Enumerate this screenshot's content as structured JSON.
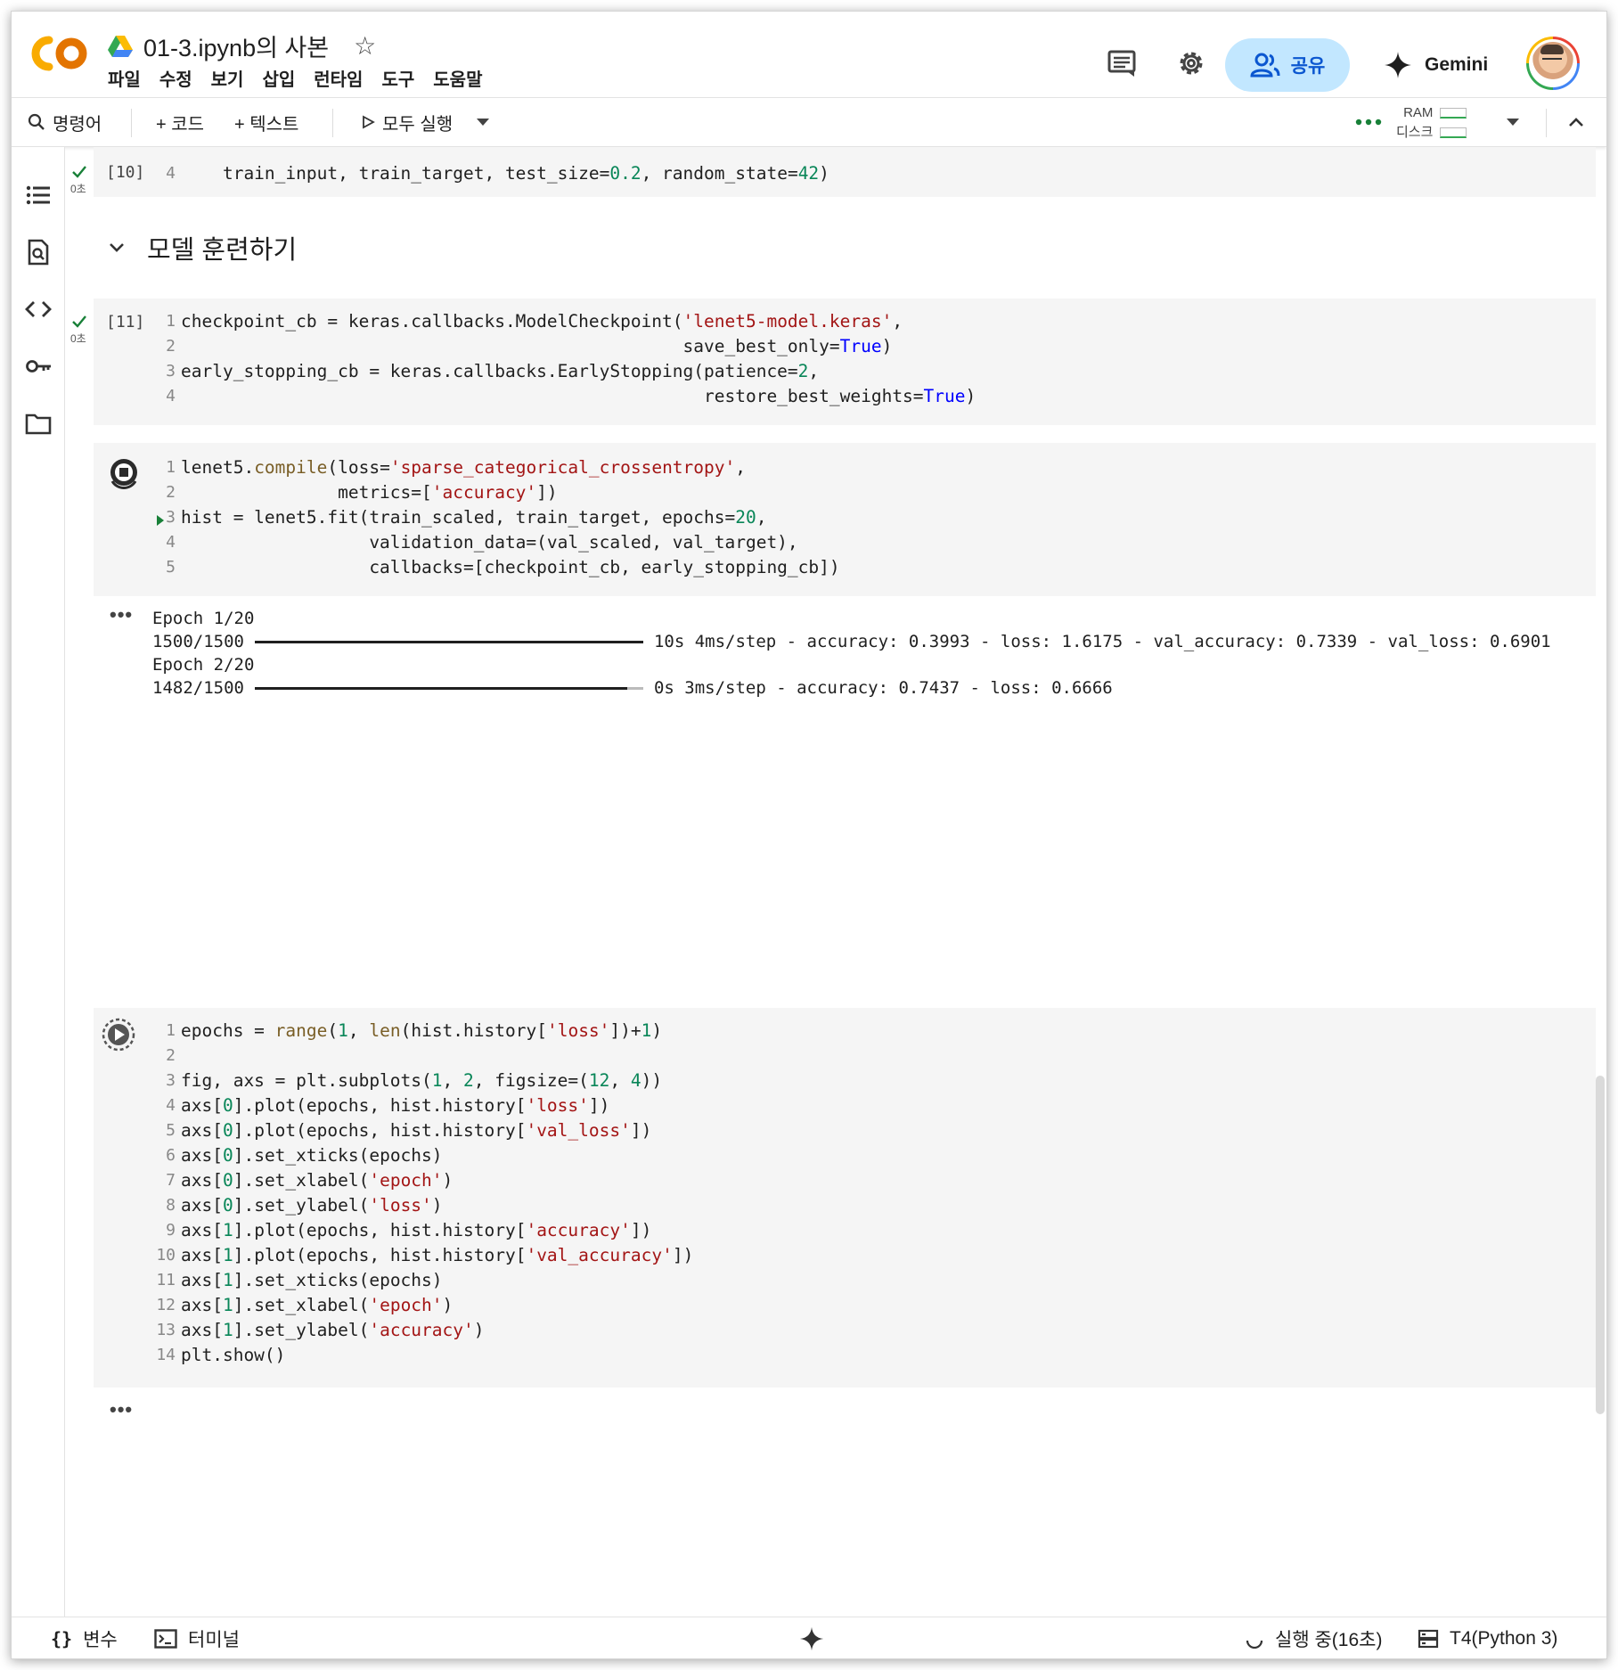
{
  "header": {
    "logo_text": "CO",
    "title": "01-3.ipynb의 사본",
    "menu": [
      "파일",
      "수정",
      "보기",
      "삽입",
      "런타임",
      "도구",
      "도움말"
    ],
    "share_label": "공유",
    "gemini_label": "Gemini"
  },
  "toolbar": {
    "commands_label": "명령어",
    "add_code_label": "+ 코드",
    "add_text_label": "+ 텍스트",
    "run_all_label": "모두 실행",
    "ram_label": "RAM",
    "disk_label": "디스크"
  },
  "cells": {
    "c10": {
      "exec_count": "[10]",
      "time": "0초",
      "lines": [
        {
          "n": "4",
          "segs": [
            [
              "",
              "    train_input, train_target, test_size="
            ],
            [
              "num",
              "0.2"
            ],
            [
              "",
              ", random_state="
            ],
            [
              "num",
              "42"
            ],
            [
              "",
              ")"
            ]
          ]
        }
      ]
    },
    "section": {
      "title": "모델 훈련하기"
    },
    "c11": {
      "exec_count": "[11]",
      "time": "0초",
      "lines": [
        {
          "n": "1",
          "segs": [
            [
              "",
              "checkpoint_cb = keras.callbacks.ModelCheckpoint("
            ],
            [
              "str",
              "'lenet5-model.keras'"
            ],
            [
              "",
              ","
            ]
          ]
        },
        {
          "n": "2",
          "segs": [
            [
              "",
              "                                                save_best_only="
            ],
            [
              "kw",
              "True"
            ],
            [
              "",
              ")"
            ]
          ]
        },
        {
          "n": "3",
          "segs": [
            [
              "",
              "early_stopping_cb = keras.callbacks.EarlyStopping(patience="
            ],
            [
              "num",
              "2"
            ],
            [
              "",
              ","
            ]
          ]
        },
        {
          "n": "4",
          "segs": [
            [
              "",
              "                                                  restore_best_weights="
            ],
            [
              "kw",
              "True"
            ],
            [
              "",
              ")"
            ]
          ]
        }
      ]
    },
    "c12": {
      "lines": [
        {
          "n": "1",
          "segs": [
            [
              "",
              "lenet5."
            ],
            [
              "fn",
              "compile"
            ],
            [
              "",
              "(loss="
            ],
            [
              "str",
              "'sparse_categorical_crossentropy'"
            ],
            [
              "",
              ","
            ]
          ]
        },
        {
          "n": "2",
          "segs": [
            [
              "",
              "               metrics=["
            ],
            [
              "str",
              "'accuracy'"
            ],
            [
              "",
              "])"
            ]
          ]
        },
        {
          "n": "3",
          "segs": [
            [
              "",
              "hist = lenet5.fit(train_scaled, train_target, epochs="
            ],
            [
              "num",
              "20"
            ],
            [
              "",
              ","
            ]
          ]
        },
        {
          "n": "4",
          "segs": [
            [
              "",
              "                  validation_data=(val_scaled, val_target),"
            ]
          ]
        },
        {
          "n": "5",
          "segs": [
            [
              "",
              "                  callbacks=[checkpoint_cb, early_stopping_cb])"
            ]
          ]
        }
      ],
      "output": {
        "epoch1": "Epoch 1/20",
        "step1": "1500/1500",
        "stats1": "10s 4ms/step - accuracy: 0.3993 - loss: 1.6175 - val_accuracy: 0.7339 - val_loss: 0.6901",
        "epoch2": "Epoch 2/20",
        "step2": "1482/1500",
        "stats2": "0s 3ms/step - accuracy: 0.7437 - loss: 0.6666"
      }
    },
    "c13": {
      "lines": [
        {
          "n": "1",
          "segs": [
            [
              "",
              "epochs = "
            ],
            [
              "fn",
              "range"
            ],
            [
              "",
              "("
            ],
            [
              "num",
              "1"
            ],
            [
              "",
              ", "
            ],
            [
              "fn",
              "len"
            ],
            [
              "",
              "(hist.history["
            ],
            [
              "str",
              "'loss'"
            ],
            [
              "",
              "])+"
            ],
            [
              "num",
              "1"
            ],
            [
              "",
              ")"
            ]
          ]
        },
        {
          "n": "2",
          "segs": [
            [
              "",
              ""
            ]
          ]
        },
        {
          "n": "3",
          "segs": [
            [
              "",
              "fig, axs = plt.subplots("
            ],
            [
              "num",
              "1"
            ],
            [
              "",
              ", "
            ],
            [
              "num",
              "2"
            ],
            [
              "",
              ", figsize=("
            ],
            [
              "num",
              "12"
            ],
            [
              "",
              ", "
            ],
            [
              "num",
              "4"
            ],
            [
              "",
              "))"
            ]
          ]
        },
        {
          "n": "4",
          "segs": [
            [
              "",
              "axs["
            ],
            [
              "num",
              "0"
            ],
            [
              "",
              "].plot(epochs, hist.history["
            ],
            [
              "str",
              "'loss'"
            ],
            [
              "",
              "])"
            ]
          ]
        },
        {
          "n": "5",
          "segs": [
            [
              "",
              "axs["
            ],
            [
              "num",
              "0"
            ],
            [
              "",
              "].plot(epochs, hist.history["
            ],
            [
              "str",
              "'val_loss'"
            ],
            [
              "",
              "])"
            ]
          ]
        },
        {
          "n": "6",
          "segs": [
            [
              "",
              "axs["
            ],
            [
              "num",
              "0"
            ],
            [
              "",
              "].set_xticks(epochs)"
            ]
          ]
        },
        {
          "n": "7",
          "segs": [
            [
              "",
              "axs["
            ],
            [
              "num",
              "0"
            ],
            [
              "",
              "].set_xlabel("
            ],
            [
              "str",
              "'epoch'"
            ],
            [
              "",
              ")"
            ]
          ]
        },
        {
          "n": "8",
          "segs": [
            [
              "",
              "axs["
            ],
            [
              "num",
              "0"
            ],
            [
              "",
              "].set_ylabel("
            ],
            [
              "str",
              "'loss'"
            ],
            [
              "",
              ")"
            ]
          ]
        },
        {
          "n": "9",
          "segs": [
            [
              "",
              "axs["
            ],
            [
              "num",
              "1"
            ],
            [
              "",
              "].plot(epochs, hist.history["
            ],
            [
              "str",
              "'accuracy'"
            ],
            [
              "",
              "])"
            ]
          ]
        },
        {
          "n": "10",
          "segs": [
            [
              "",
              "axs["
            ],
            [
              "num",
              "1"
            ],
            [
              "",
              "].plot(epochs, hist.history["
            ],
            [
              "str",
              "'val_accuracy'"
            ],
            [
              "",
              "])"
            ]
          ]
        },
        {
          "n": "11",
          "segs": [
            [
              "",
              "axs["
            ],
            [
              "num",
              "1"
            ],
            [
              "",
              "].set_xticks(epochs)"
            ]
          ]
        },
        {
          "n": "12",
          "segs": [
            [
              "",
              "axs["
            ],
            [
              "num",
              "1"
            ],
            [
              "",
              "].set_xlabel("
            ],
            [
              "str",
              "'epoch'"
            ],
            [
              "",
              ")"
            ]
          ]
        },
        {
          "n": "13",
          "segs": [
            [
              "",
              "axs["
            ],
            [
              "num",
              "1"
            ],
            [
              "",
              "].set_ylabel("
            ],
            [
              "str",
              "'accuracy'"
            ],
            [
              "",
              ")"
            ]
          ]
        },
        {
          "n": "14",
          "segs": [
            [
              "",
              "plt.show()"
            ]
          ]
        }
      ]
    }
  },
  "statusbar": {
    "variables_label": "변수",
    "terminal_label": "터미널",
    "running_label": "실행 중(16초)",
    "runtime_label": "T4(Python 3)"
  },
  "colors": {
    "accent_blue": "#0b57d0",
    "share_bg": "#c2e7ff",
    "success_green": "#34a853",
    "logo_orange": "#f9ab00"
  }
}
